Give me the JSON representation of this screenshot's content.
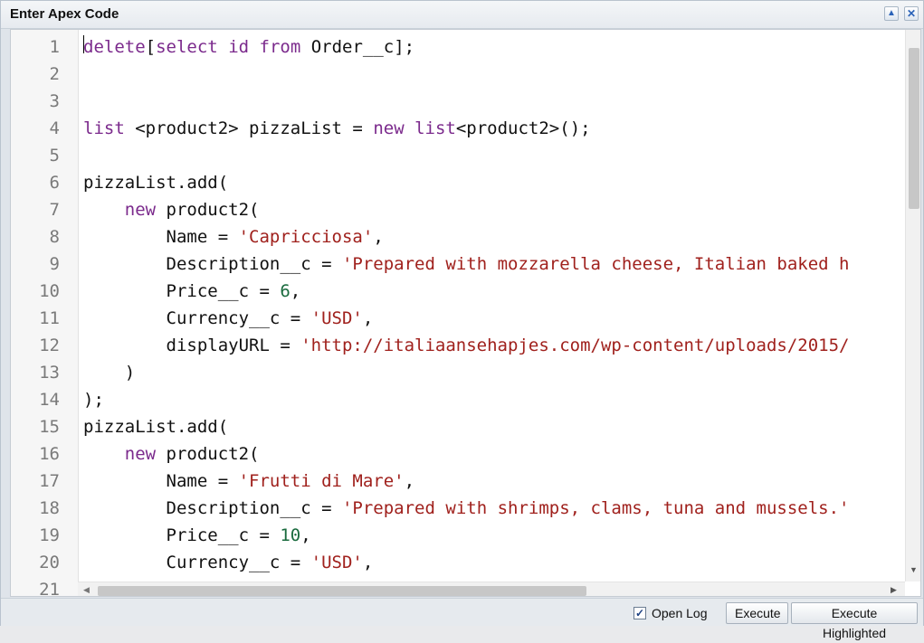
{
  "window": {
    "title": "Enter Apex Code",
    "icons": {
      "collapse": "chevron-up-icon",
      "close": "close-icon"
    }
  },
  "editor": {
    "lines": [
      {
        "n": "1",
        "segs": [
          {
            "t": "delete",
            "c": "kw"
          },
          {
            "t": "["
          },
          {
            "t": "select",
            "c": "kw"
          },
          {
            "t": " "
          },
          {
            "t": "id",
            "c": "kw"
          },
          {
            "t": " "
          },
          {
            "t": "from",
            "c": "kw"
          },
          {
            "t": " Order__c];"
          }
        ]
      },
      {
        "n": "2",
        "segs": []
      },
      {
        "n": "3",
        "segs": []
      },
      {
        "n": "4",
        "segs": [
          {
            "t": "list",
            "c": "kw"
          },
          {
            "t": " <product2> pizzaList = "
          },
          {
            "t": "new",
            "c": "kw"
          },
          {
            "t": " "
          },
          {
            "t": "list",
            "c": "kw"
          },
          {
            "t": "<product2>();"
          }
        ]
      },
      {
        "n": "5",
        "segs": []
      },
      {
        "n": "6",
        "segs": [
          {
            "t": "pizzaList.add("
          }
        ]
      },
      {
        "n": "7",
        "segs": [
          {
            "t": "    "
          },
          {
            "t": "new",
            "c": "kw"
          },
          {
            "t": " product2("
          }
        ]
      },
      {
        "n": "8",
        "segs": [
          {
            "t": "        Name = "
          },
          {
            "t": "'Capricciosa'",
            "c": "str"
          },
          {
            "t": ","
          }
        ]
      },
      {
        "n": "9",
        "segs": [
          {
            "t": "        Description__c = "
          },
          {
            "t": "'Prepared with mozzarella cheese, Italian baked h",
            "c": "str"
          }
        ]
      },
      {
        "n": "10",
        "segs": [
          {
            "t": "        Price__c = "
          },
          {
            "t": "6",
            "c": "num"
          },
          {
            "t": ","
          }
        ]
      },
      {
        "n": "11",
        "segs": [
          {
            "t": "        Currency__c = "
          },
          {
            "t": "'USD'",
            "c": "str"
          },
          {
            "t": ","
          }
        ]
      },
      {
        "n": "12",
        "segs": [
          {
            "t": "        displayURL = "
          },
          {
            "t": "'http://italiaansehapjes.com/wp-content/uploads/2015/",
            "c": "str"
          }
        ]
      },
      {
        "n": "13",
        "segs": [
          {
            "t": "    )"
          }
        ]
      },
      {
        "n": "14",
        "segs": [
          {
            "t": ");"
          }
        ]
      },
      {
        "n": "15",
        "segs": [
          {
            "t": "pizzaList.add("
          }
        ]
      },
      {
        "n": "16",
        "segs": [
          {
            "t": "    "
          },
          {
            "t": "new",
            "c": "kw"
          },
          {
            "t": " product2("
          }
        ]
      },
      {
        "n": "17",
        "segs": [
          {
            "t": "        Name = "
          },
          {
            "t": "'Frutti di Mare'",
            "c": "str"
          },
          {
            "t": ","
          }
        ]
      },
      {
        "n": "18",
        "segs": [
          {
            "t": "        Description__c = "
          },
          {
            "t": "'Prepared with shrimps, clams, tuna and mussels.'",
            "c": "str"
          }
        ]
      },
      {
        "n": "19",
        "segs": [
          {
            "t": "        Price__c = "
          },
          {
            "t": "10",
            "c": "num"
          },
          {
            "t": ","
          }
        ]
      },
      {
        "n": "20",
        "segs": [
          {
            "t": "        Currency__c = "
          },
          {
            "t": "'USD'",
            "c": "str"
          },
          {
            "t": ","
          }
        ]
      },
      {
        "n": "21",
        "segs": []
      }
    ]
  },
  "footer": {
    "open_log_checked": true,
    "open_log_label": "Open Log",
    "execute_label": "Execute",
    "execute_highlighted_label": "Execute Highlighted"
  },
  "colors": {
    "keyword": "#7b2a8c",
    "string": "#a0211d",
    "number": "#1a6b3e"
  }
}
